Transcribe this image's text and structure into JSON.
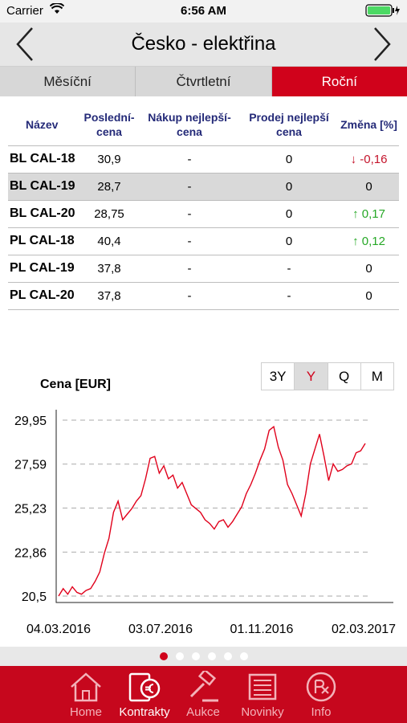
{
  "status_bar": {
    "carrier": "Carrier",
    "time": "6:56 AM"
  },
  "nav": {
    "title": "Česko - elektřina"
  },
  "segments": [
    {
      "label": "Měsíční",
      "active": false
    },
    {
      "label": "Čtvrtletní",
      "active": false
    },
    {
      "label": "Roční",
      "active": true
    }
  ],
  "table": {
    "headers": [
      "Název",
      "Poslední-cena",
      "Nákup nejlepší-cena",
      "Prodej nejlepší cena",
      "Změna [%]"
    ],
    "rows": [
      {
        "name": "BL CAL-18",
        "last": "30,9",
        "buy": "-",
        "sell": "0",
        "change": "↓ -0,16",
        "dir": "down"
      },
      {
        "name": "BL CAL-19",
        "last": "28,7",
        "buy": "-",
        "sell": "0",
        "change": "0",
        "dir": "none"
      },
      {
        "name": "BL CAL-20",
        "last": "28,75",
        "buy": "-",
        "sell": "0",
        "change": "↑ 0,17",
        "dir": "up"
      },
      {
        "name": "PL CAL-18",
        "last": "40,4",
        "buy": "-",
        "sell": "0",
        "change": "↑ 0,12",
        "dir": "up"
      },
      {
        "name": "PL CAL-19",
        "last": "37,8",
        "buy": "-",
        "sell": "-",
        "change": "0",
        "dir": "none"
      },
      {
        "name": "PL CAL-20",
        "last": "37,8",
        "buy": "-",
        "sell": "-",
        "change": "0",
        "dir": "none"
      }
    ]
  },
  "periods": [
    {
      "label": "3Y",
      "active": false
    },
    {
      "label": "Y",
      "active": true
    },
    {
      "label": "Q",
      "active": false
    },
    {
      "label": "M",
      "active": false
    }
  ],
  "chart_data": {
    "type": "line",
    "ylabel": "Cena [EUR]",
    "ylim": [
      20.5,
      29.95
    ],
    "y_ticks": [
      "29,95",
      "27,59",
      "25,23",
      "22,86",
      "20,5"
    ],
    "y_tick_values": [
      29.95,
      27.59,
      25.23,
      22.86,
      20.5
    ],
    "x_ticks": [
      "04.03.2016",
      "03.07.2016",
      "01.11.2016",
      "02.03.2017"
    ],
    "grid": "horizontal dashed",
    "line_color": "#e0001b",
    "series": [
      {
        "values": [
          20.5,
          20.9,
          20.6,
          21.0,
          20.7,
          20.6,
          20.8,
          20.9,
          21.3,
          21.8,
          22.8,
          23.6,
          25.0,
          25.6,
          24.6,
          24.9,
          25.2,
          25.6,
          25.9,
          26.8,
          27.9,
          28.0,
          27.1,
          27.5,
          26.8,
          27.0,
          26.3,
          26.6,
          26.0,
          25.4,
          25.2,
          25.0,
          24.6,
          24.4,
          24.1,
          24.5,
          24.6,
          24.2,
          24.5,
          24.9,
          25.3,
          26.0,
          26.5,
          27.1,
          27.8,
          28.4,
          29.4,
          29.6,
          28.5,
          27.8,
          26.5,
          26.0,
          25.4,
          24.8,
          26.0,
          27.6,
          28.4,
          29.2,
          28.0,
          26.7,
          27.6,
          27.2,
          27.3,
          27.5,
          27.6,
          28.2,
          28.3,
          28.7
        ]
      }
    ]
  },
  "pager": {
    "count": 6,
    "active": 0
  },
  "tabbar": [
    {
      "label": "Home",
      "icon": "home-icon",
      "active": false
    },
    {
      "label": "Kontrakty",
      "icon": "contracts-euro-icon",
      "active": true
    },
    {
      "label": "Aukce",
      "icon": "gavel-icon",
      "active": false
    },
    {
      "label": "Novinky",
      "icon": "news-icon",
      "active": false
    },
    {
      "label": "Info",
      "icon": "info-icon",
      "active": false
    }
  ]
}
